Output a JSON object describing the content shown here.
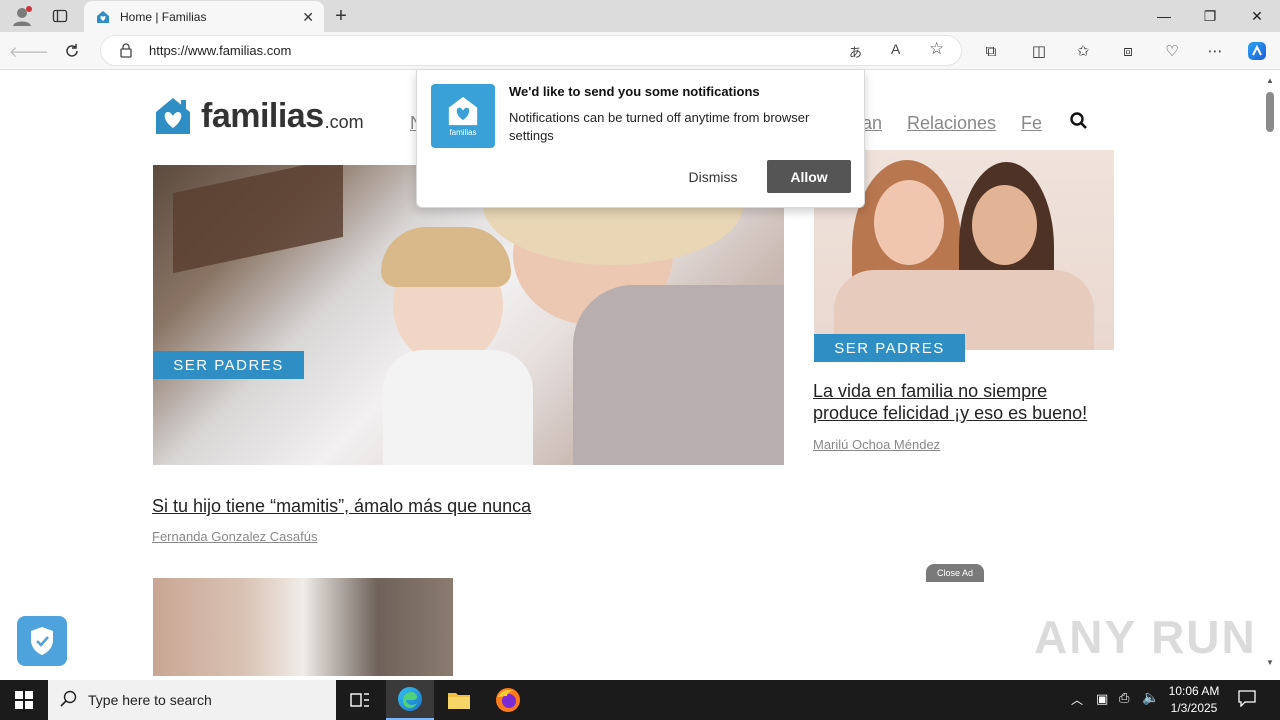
{
  "browser": {
    "tab_title": "Home | Familias",
    "address": "https://www.familias.com",
    "new_tab_label": "+"
  },
  "site": {
    "logo_text": "familias",
    "logo_suffix": ".com",
    "nav": [
      "N",
      "an",
      "Relaciones",
      "Fe"
    ]
  },
  "notification": {
    "title": "We'd like to send you some notifications",
    "body": "Notifications can be turned off anytime from browser settings",
    "icon_text": "familias",
    "dismiss_label": "Dismiss",
    "allow_label": "Allow"
  },
  "articles": [
    {
      "category": "SER PADRES",
      "title": "Si tu hijo tiene “mamitis”, ámalo más que nunca",
      "author": "Fernanda Gonzalez Casafús"
    },
    {
      "category": "SER PADRES",
      "title": "La vida en familia no siempre produce felicidad ¡y eso es bueno!",
      "author": "Marilú Ochoa Méndez"
    }
  ],
  "ad": {
    "close_label": "Close Ad"
  },
  "watermark": "ANY RUN",
  "taskbar": {
    "search_placeholder": "Type here to search",
    "time": "10:06 AM",
    "date": "1/3/2025"
  },
  "colors": {
    "brand_blue": "#2f8fc4",
    "allow_button": "#555555"
  }
}
